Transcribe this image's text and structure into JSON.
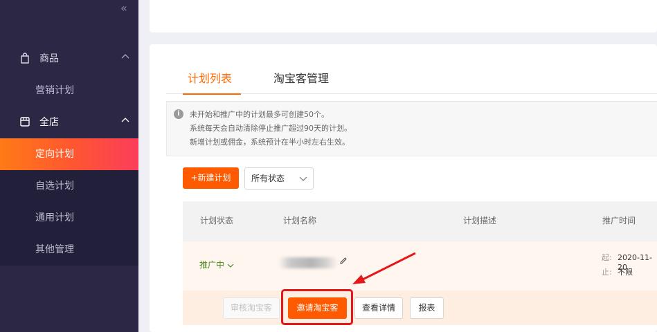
{
  "sidebar": {
    "collapse_icon": "double-chevron-left-icon",
    "groups": [
      {
        "label": "商品",
        "icon": "bag-icon",
        "expanded": true
      },
      {
        "label": "全店",
        "icon": "store-icon",
        "expanded": true
      }
    ],
    "items": [
      {
        "label": "营销计划"
      },
      {
        "label": "定向计划",
        "active": true
      },
      {
        "label": "自选计划"
      },
      {
        "label": "通用计划"
      },
      {
        "label": "其他管理"
      }
    ]
  },
  "tabs": [
    {
      "label": "计划列表",
      "active": true
    },
    {
      "label": "淘宝客管理",
      "active": false
    }
  ],
  "notice": {
    "lines": [
      "未开始和推广中的计划最多可创建50个。",
      "系统每天会自动清除停止推广超过90天的计划。",
      "新增计划或佣金，系统预计在半小时左右生效。"
    ]
  },
  "toolbar": {
    "new_plan": "+新建计划",
    "status_filter": "所有状态"
  },
  "table": {
    "headers": [
      "计划状态",
      "计划名称",
      "计划描述",
      "推广时间"
    ],
    "rows": [
      {
        "status": "推广中",
        "start_label": "起:",
        "start_value": "2020-11-20",
        "end_label": "止:",
        "end_value": "不限"
      }
    ],
    "actions": {
      "review": "审核淘宝客",
      "invite": "邀请淘宝客",
      "details": "查看详情",
      "report": "报表"
    }
  },
  "colors": {
    "accent": "#ff5a00",
    "sidebar_bg": "#2b2744",
    "active_gradient_start": "#ff7a16",
    "active_gradient_end": "#fb3d5b",
    "status_green": "#4a8a1c",
    "highlight_red": "#e3181b"
  }
}
